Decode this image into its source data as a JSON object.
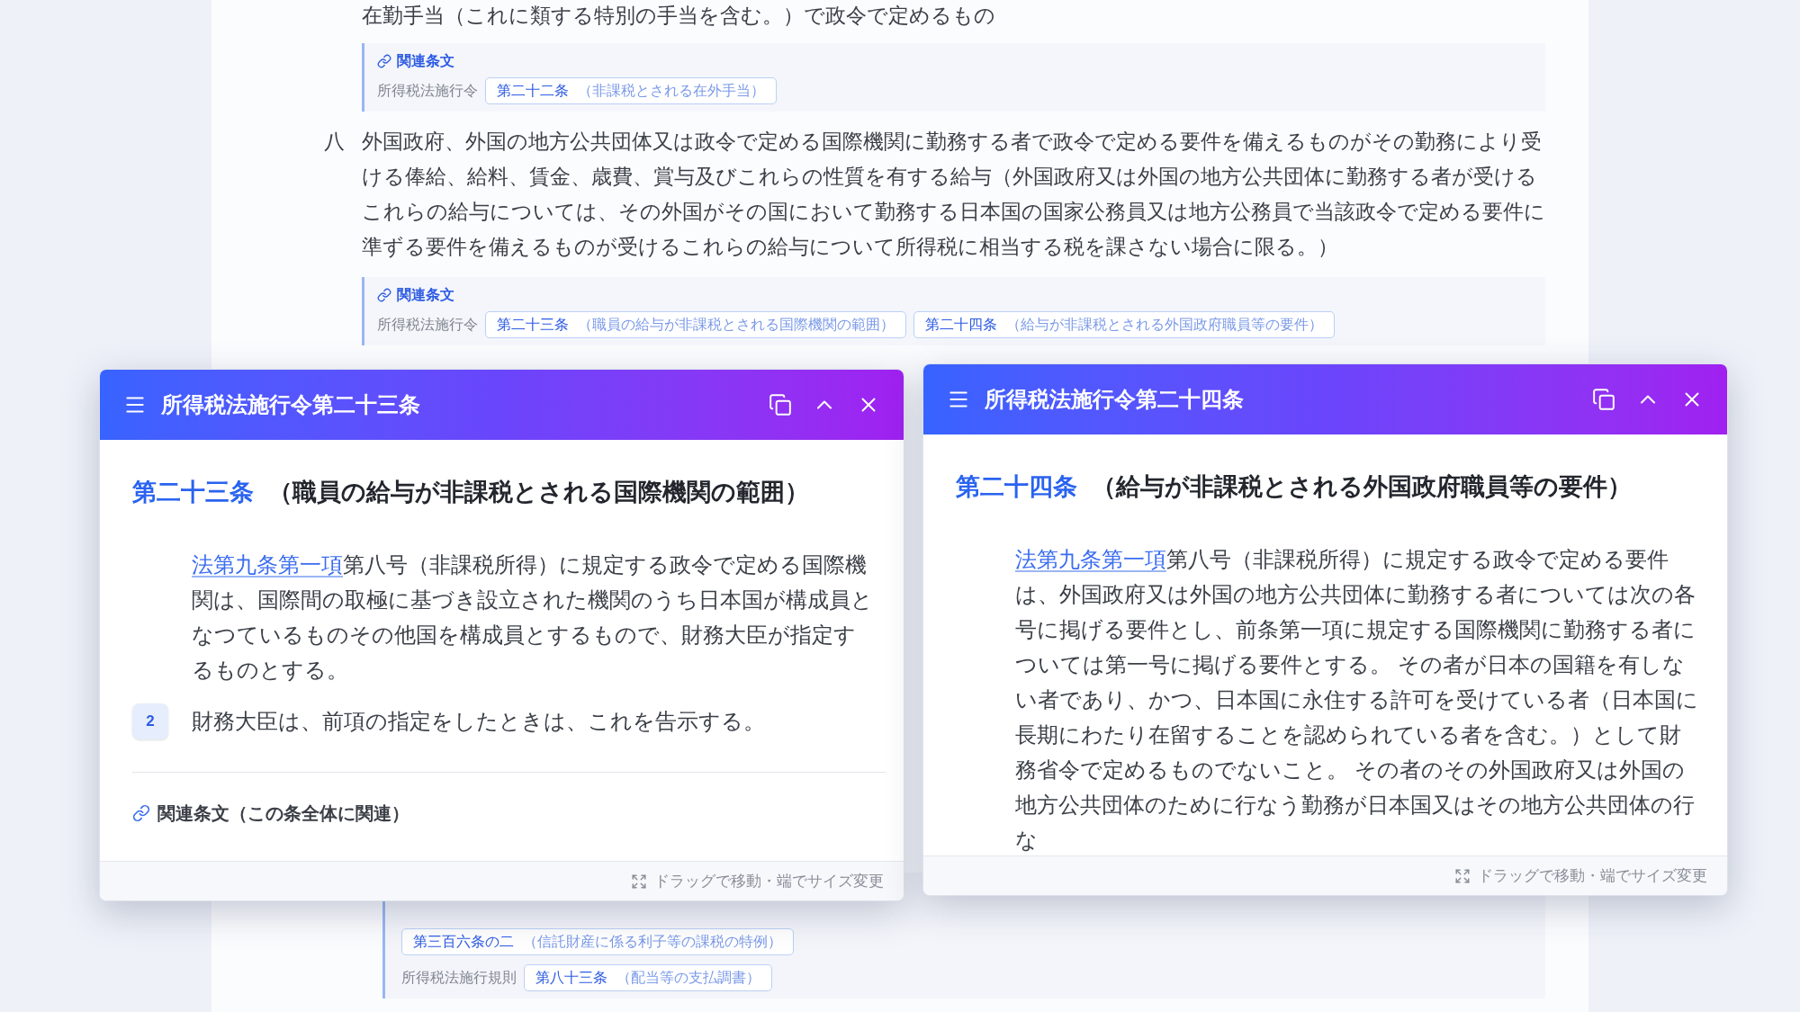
{
  "document": {
    "items": [
      {
        "kind": "text",
        "text": "在勤手当（これに類する特別の手当を含む。）で政令で定めるもの"
      },
      {
        "kind": "related",
        "heading": "関連条文",
        "groups": [
          {
            "law": "所得税法施行令",
            "refs": [
              {
                "article": "第二十二条",
                "title": "（非課税とされる在外手当）"
              }
            ]
          }
        ]
      },
      {
        "kind": "numbered",
        "number": "八",
        "text": "外国政府、外国の地方公共団体又は政令で定める国際機関に勤務する者で政令で定める要件を備えるものがその勤務により受ける俸給、給料、賃金、歳費、賞与及びこれらの性質を有する給与（外国政府又は外国の地方公共団体に勤務する者が受けるこれらの給与については、その外国がその国において勤務する日本国の国家公務員又は地方公務員で当該政令で定める要件に準ずる要件を備えるものが受けるこれらの給与について所得税に相当する税を課さない場合に限る。）"
      },
      {
        "kind": "related",
        "heading": "関連条文",
        "groups": [
          {
            "law": "所得税法施行令",
            "refs": [
              {
                "article": "第二十三条",
                "title": "（職員の給与が非課税とされる国際機関の範囲）"
              },
              {
                "article": "第二十四条",
                "title": "（給与が非課税とされる外国政府職員等の要件）"
              }
            ]
          }
        ]
      }
    ],
    "bottom_related": {
      "groups": [
        {
          "refs": [
            {
              "article": "第三百六条の二",
              "title": "（信託財産に係る利子等の課税の特例）"
            }
          ]
        },
        {
          "law": "所得税法施行規則",
          "refs": [
            {
              "article": "第八十三条",
              "title": "（配当等の支払調書）"
            }
          ]
        }
      ]
    }
  },
  "panels": [
    {
      "title": "所得税法施行令第二十三条",
      "article": "第二十三条",
      "caption": "（職員の給与が非課税とされる国際機関の範囲）",
      "paragraphs": [
        {
          "link": "法第九条第一項",
          "text": "第八号（非課税所得）に規定する政令で定める国際機関は、国際間の取極に基づき設立された機関のうち日本国が構成員となつているものその他国を構成員とするもので、財務大臣が指定するものとする。"
        },
        {
          "number": "2",
          "text": "財務大臣は、前項の指定をしたときは、これを告示する。"
        }
      ],
      "related_heading": "関連条文（この条全体に関連）",
      "footer": "ドラッグで移動・端でサイズ変更"
    },
    {
      "title": "所得税法施行令第二十四条",
      "article": "第二十四条",
      "caption": "（給与が非課税とされる外国政府職員等の要件）",
      "paragraphs": [
        {
          "link": "法第九条第一項",
          "text": "第八号（非課税所得）に規定する政令で定める要件は、外国政府又は外国の地方公共団体に勤務する者については次の各号に掲げる要件とし、前条第一項に規定する国際機関に勤務する者については第一号に掲げる要件とする。 その者が日本の国籍を有しない者であり、かつ、日本国に永住する許可を受けている者（日本国に長期にわたり在留することを認められている者を含む。）として財務省令で定めるものでないこと。 その者のその外国政府又は外国の地方公共団体のために行なう勤務が日本国又はその地方公共団体の行な"
        }
      ],
      "footer": "ドラッグで移動・端でサイズ変更"
    }
  ]
}
